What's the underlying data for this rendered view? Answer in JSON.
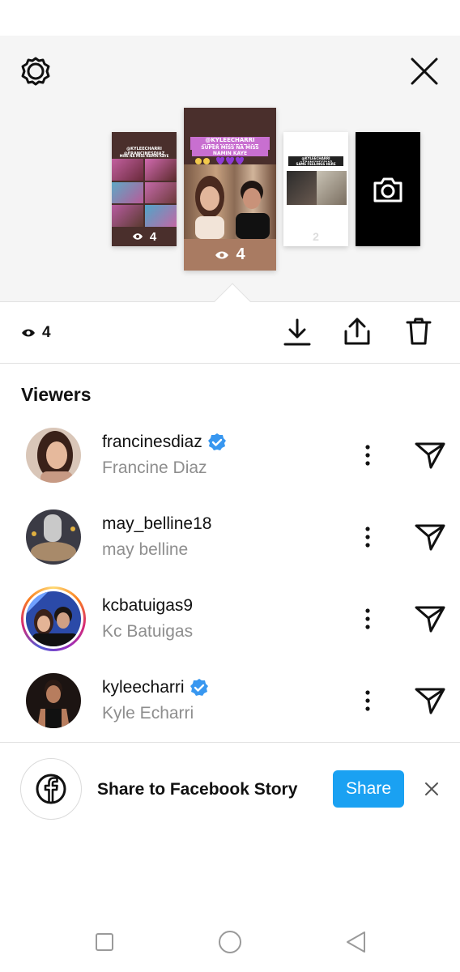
{
  "header": {
    "settings_icon": "gear-icon",
    "close_icon": "close-icon"
  },
  "stories": [
    {
      "caption": "@KYLEECHARRI @FRANCINESDIAZ",
      "caption2": "MISS NA MISS NAMIN KAYE",
      "views": "4"
    },
    {
      "caption": "@KYLEECHARRI @FRANCINESDIAZ",
      "caption2": "SUPER MISS NA MISS NAMIN KAYE",
      "views": "4"
    },
    {
      "caption": "@KYLEECHARRI @FRANCINESDIAZ",
      "caption2": "SAME FEELINGS HERE",
      "views": "2"
    }
  ],
  "action_bar": {
    "view_count": "4",
    "icons": [
      "eye-icon",
      "download-icon",
      "share-icon",
      "trash-icon"
    ]
  },
  "viewers_title": "Viewers",
  "viewers": [
    {
      "username": "francinesdiaz",
      "full_name": "Francine Diaz",
      "verified": true
    },
    {
      "username": "may_belline18",
      "full_name": "may belline",
      "verified": false
    },
    {
      "username": "kcbatuigas9",
      "full_name": "Kc Batuigas",
      "verified": false
    },
    {
      "username": "kyleecharri",
      "full_name": "Kyle Echarri",
      "verified": true
    }
  ],
  "facebook_share": {
    "label": "Share to Facebook Story",
    "button": "Share"
  },
  "colors": {
    "accent": "#1aa1f2",
    "verified": "#3897f0",
    "secondary_text": "#8e8e8e",
    "tray_bg": "#f5f5f5"
  }
}
